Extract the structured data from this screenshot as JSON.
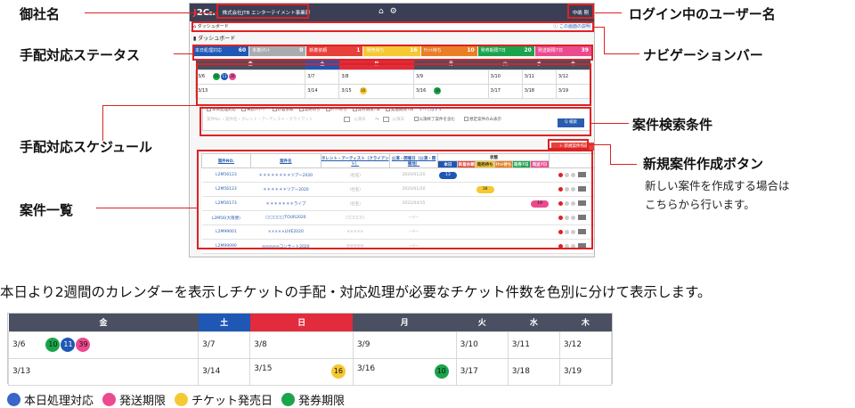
{
  "callouts": {
    "company": "御社名",
    "status": "手配対応ステータス",
    "schedule": "手配対応スケジュール",
    "cases": "案件一覧",
    "login": "ログイン中のユーザー名",
    "nav": "ナビゲーションバー",
    "search": "案件検索条件",
    "newcase": "新規案件作成ボタン",
    "newcase_note1": "新しい案件を作成する場合は",
    "newcase_note2": "こちらから行います。"
  },
  "app": {
    "logo_j": "J",
    "logo_rest": "2C",
    "logo_small": "Ex",
    "company": "株式会社JTB エンターテイメント事業部",
    "home_icon": "⌂",
    "gear_icon": "⚙",
    "user": "中嶋 剛",
    "crumb": "ダッシュボード",
    "help": "この画面の説明",
    "dash_title": "ダッシュボード"
  },
  "statuses": [
    {
      "label": "本日処理対応",
      "count": "60",
      "color": "#1f57b4"
    },
    {
      "label": "未着ｶｳﾝﾄ",
      "count": "0",
      "color": "#a9abb0"
    },
    {
      "label": "新着依頼",
      "count": "1",
      "color": "#e8403b"
    },
    {
      "label": "発売待ち",
      "count": "16",
      "color": "#f6c832"
    },
    {
      "label": "ﾁｹｯﾄ待ち",
      "count": "10",
      "color": "#e97e26"
    },
    {
      "label": "発券期限7日",
      "count": "20",
      "color": "#1aa44b"
    },
    {
      "label": "発送期限7日",
      "count": "39",
      "color": "#ec4a8f"
    }
  ],
  "calendar": {
    "headers": [
      "金",
      "土",
      "日",
      "月",
      "火",
      "水",
      "木"
    ],
    "header_colors": [
      "#4a4f62",
      "#1f57b4",
      "#e22b3c",
      "#4a4f62",
      "#4a4f62",
      "#4a4f62",
      "#4a4f62"
    ],
    "week1": [
      "3/6",
      "3/7",
      "3/8",
      "3/9",
      "3/10",
      "3/11",
      "3/12"
    ],
    "week2": [
      "3/13",
      "3/14",
      "3/15",
      "3/16",
      "3/17",
      "3/18",
      "3/19"
    ],
    "badges_3_6": [
      {
        "value": "10",
        "color": "#1aa44b"
      },
      {
        "value": "11",
        "color": "#1f57b4"
      },
      {
        "value": "39",
        "color": "#ec4a8f"
      }
    ],
    "badge_3_15": {
      "value": "16",
      "color": "#f6c832"
    },
    "badge_3_16": {
      "value": "10",
      "color": "#1aa44b"
    }
  },
  "search": {
    "checks": [
      "本日処理対応",
      "未読ﾒｯｾｰｼﾞ",
      "新着依頼",
      "発売待ち",
      "ﾁｹｯﾄ待ち",
      "発券期限7日",
      "発送期限7日"
    ],
    "select_all": "すべてはずす",
    "keyword_placeholder": "案件No.・案件名・タレント・アーティスト・クライアント",
    "date1": "公演日",
    "date2": "公演日",
    "opt1": "公演終了案件を含む",
    "opt2": "想定案件のみ表示",
    "button": "Q 検索"
  },
  "newcase_button": "＋ 新規案件作成",
  "cases": {
    "headers": [
      "案件NO.",
      "案件名",
      "タレント・アーティスト（クライアント）",
      "公演・開催日（公演・開催地）",
      "状態"
    ],
    "state_heads": [
      "本日",
      "新着依頼",
      "発売待ち",
      "ﾁｹｯﾄ待ち",
      "発券7日",
      "発送7日"
    ],
    "state_colors": [
      "#1f57b4",
      "#e8403b",
      "#f6c832",
      "#e97e26",
      "#1aa44b",
      "#ec4a8f"
    ],
    "rows": [
      {
        "no": "L2M56123",
        "name": "＊＊＊＊＊＊＊＊ツアー2020",
        "talent": "（社名）",
        "date": "2020/01/20",
        "badge": "13",
        "bcolor": "#1f57b4",
        "bcol": 0
      },
      {
        "no": "L2M56123",
        "name": "＊＊＊＊＊＊ツアー2020",
        "talent": "（社名）",
        "date": "2020/01/20",
        "badge": "16",
        "bcolor": "#f6c832",
        "bcol": 2
      },
      {
        "no": "L2M56173",
        "name": "＊＊＊＊＊＊＊ライブ",
        "talent": "（社名）",
        "date": "2022/04/15",
        "badge": "19",
        "bcolor": "#ec4a8f",
        "bcol": 5
      },
      {
        "no": "L2M56(大阪便)",
        "name": "□□□□□TOUR2020",
        "talent": "□□□□□",
        "date": "---/---",
        "badge": "",
        "bcolor": "",
        "bcol": -1
      },
      {
        "no": "L2M99001",
        "name": "×××××LIVE2020",
        "talent": "×××××",
        "date": "---/---",
        "badge": "",
        "bcolor": "",
        "bcol": -1
      },
      {
        "no": "L2M99090",
        "name": "◎◎◎◎◎コンサート2020",
        "talent": "◎◎◎◎◎",
        "date": "---/---",
        "badge": "",
        "bcolor": "",
        "bcol": -1
      }
    ]
  },
  "description": "本日より2週間のカレンダーを表示しチケットの手配・対応処理が必要なチケット件数を色別に分けて表示します。",
  "legend": [
    {
      "label": "本日処理対応",
      "color": "#3a66c8"
    },
    {
      "label": "発送期限",
      "color": "#ec4a8f"
    },
    {
      "label": "チケット発売日",
      "color": "#f6c832"
    },
    {
      "label": "発券期限",
      "color": "#1aa44b"
    }
  ]
}
